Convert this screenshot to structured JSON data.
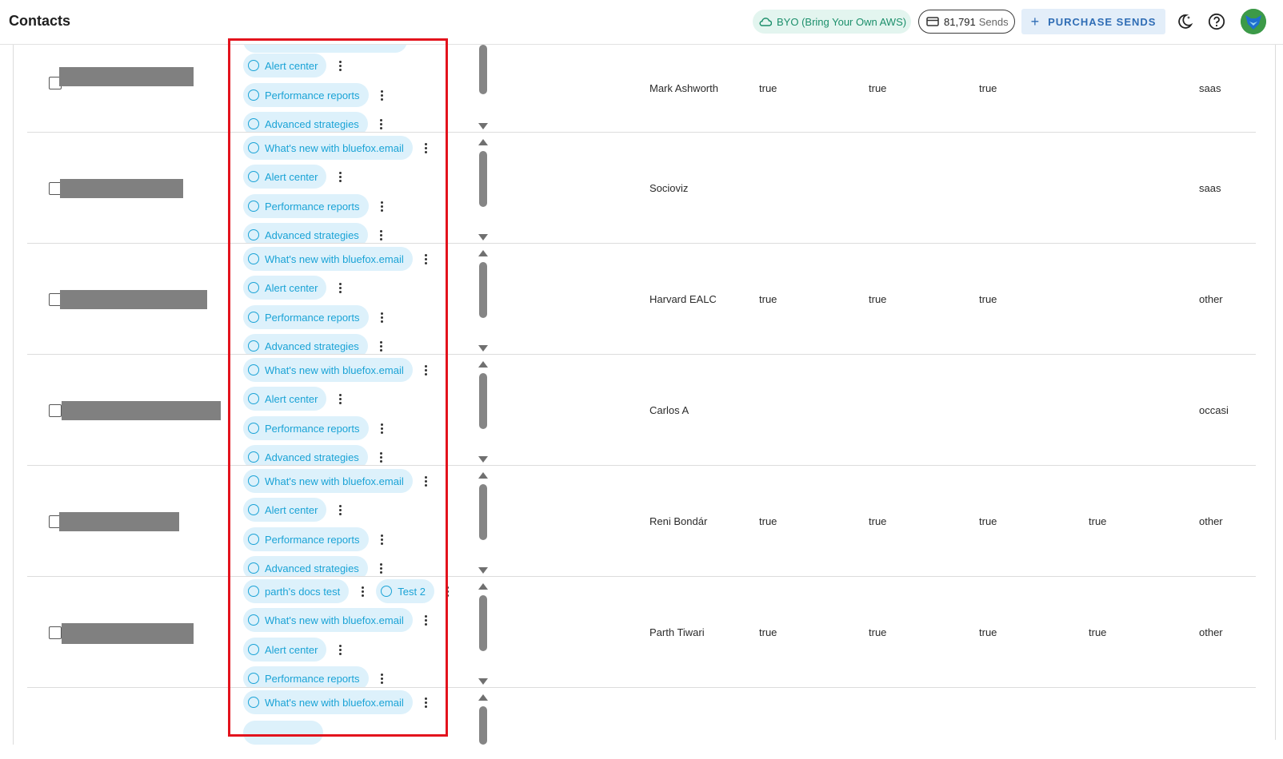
{
  "header": {
    "title": "Contacts",
    "byo_label": "BYO (Bring Your Own AWS)",
    "sends_count": "81,791",
    "sends_unit": "Sends",
    "purchase_label": "PURCHASE SENDS"
  },
  "colors": {
    "accent": "#1aa3d6",
    "chip_bg": "#ddf1fb",
    "byo_bg": "#e3f5ef",
    "byo_text": "#1c8f6b",
    "purchase_bg": "#e3eef9",
    "purchase_text": "#2f6db5",
    "highlight": "#e3131d"
  },
  "rows": [
    {
      "tags": [
        "",
        "Alert center",
        "Performance reports",
        "Advanced strategies"
      ],
      "company": "Mark Ashworth",
      "f1": "true",
      "f2": "true",
      "f3": "true",
      "f4": "",
      "segment": "saas"
    },
    {
      "tags": [
        "What's new with bluefox.email",
        "Alert center",
        "Performance reports",
        "Advanced strategies"
      ],
      "company": "Socioviz",
      "f1": "",
      "f2": "",
      "f3": "",
      "f4": "",
      "segment": "saas"
    },
    {
      "tags": [
        "What's new with bluefox.email",
        "Alert center",
        "Performance reports",
        "Advanced strategies"
      ],
      "company": "Harvard EALC",
      "f1": "true",
      "f2": "true",
      "f3": "true",
      "f4": "",
      "segment": "other"
    },
    {
      "tags": [
        "What's new with bluefox.email",
        "Alert center",
        "Performance reports",
        "Advanced strategies"
      ],
      "company": "Carlos A",
      "f1": "",
      "f2": "",
      "f3": "",
      "f4": "",
      "segment": "occasi"
    },
    {
      "tags": [
        "What's new with bluefox.email",
        "Alert center",
        "Performance reports",
        "Advanced strategies"
      ],
      "company": "Reni Bondár",
      "f1": "true",
      "f2": "true",
      "f3": "true",
      "f4": "true",
      "segment": "other"
    },
    {
      "tags": [
        "parth's docs test",
        "What's new with bluefox.email",
        "Alert center",
        "Performance reports"
      ],
      "extra_tag": "Test 2",
      "company": "Parth Tiwari",
      "f1": "true",
      "f2": "true",
      "f3": "true",
      "f4": "true",
      "segment": "other"
    },
    {
      "tags": [
        "What's new with bluefox.email"
      ],
      "company": "",
      "f1": "",
      "f2": "",
      "f3": "",
      "f4": "",
      "segment": ""
    }
  ]
}
